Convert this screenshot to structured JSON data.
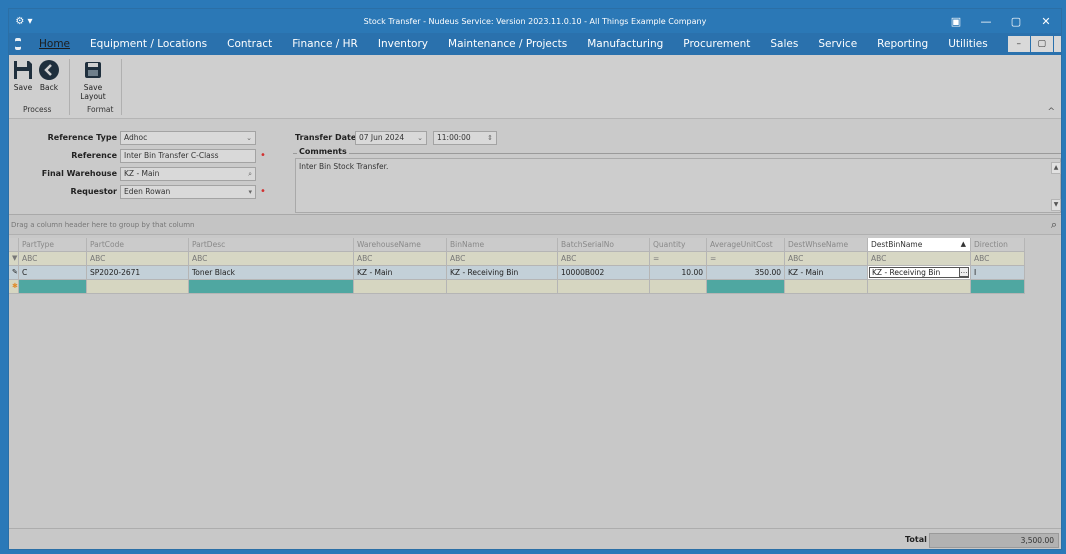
{
  "window": {
    "title": "Stock Transfer - Nudeus Service: Version 2023.11.0.10 - All Things Example Company",
    "controls": [
      "▣",
      "—",
      "▢",
      "✕"
    ]
  },
  "menu": {
    "items": [
      "Home",
      "Equipment / Locations",
      "Contract",
      "Finance / HR",
      "Inventory",
      "Maintenance / Projects",
      "Manufacturing",
      "Procurement",
      "Sales",
      "Service",
      "Reporting",
      "Utilities"
    ],
    "mdi_controls": [
      "–",
      "▢",
      "✕"
    ]
  },
  "ribbon": {
    "save": "Save",
    "back": "Back",
    "save_layout": "Save Layout",
    "group_process": "Process",
    "group_format": "Format"
  },
  "form": {
    "reference_type_label": "Reference Type",
    "reference_type_value": "Adhoc",
    "reference_label": "Reference",
    "reference_value": "Inter Bin Transfer C-Class",
    "final_warehouse_label": "Final Warehouse",
    "final_warehouse_value": "KZ - Main",
    "requestor_label": "Requestor",
    "requestor_value": "Eden Rowan",
    "transfer_date_label": "Transfer Date",
    "transfer_date_value": "07 Jun 2024",
    "transfer_time_value": "11:00:00",
    "comments_label": "Comments",
    "comments_value": "Inter Bin Stock Transfer."
  },
  "grid": {
    "group_hint": "Drag a column header here to group by that column",
    "columns": [
      "PartType",
      "PartCode",
      "PartDesc",
      "WarehouseName",
      "BinName",
      "BatchSerialNo",
      "Quantity",
      "AverageUnitCost",
      "DestWhseName",
      "DestBinName",
      "Direction"
    ],
    "filters": [
      "ABC",
      "ABC",
      "ABC",
      "ABC",
      "ABC",
      "ABC",
      "=",
      "=",
      "ABC",
      "ABC",
      "ABC"
    ],
    "rows": [
      [
        "C",
        "SP2020-2671",
        "Toner Black",
        "KZ - Main",
        "KZ - Receiving Bin",
        "10000B002",
        "10.00",
        "350.00",
        "KZ - Main",
        "KZ - Receiving Bin",
        "I"
      ]
    ]
  },
  "footer": {
    "total_label": "Total",
    "total_value": "3,500.00"
  },
  "colors": {
    "titlebar": "#2b78b6",
    "menubar": "#2a71ad",
    "required": "#d23030",
    "new_row_teal": "#4fa7a1"
  }
}
